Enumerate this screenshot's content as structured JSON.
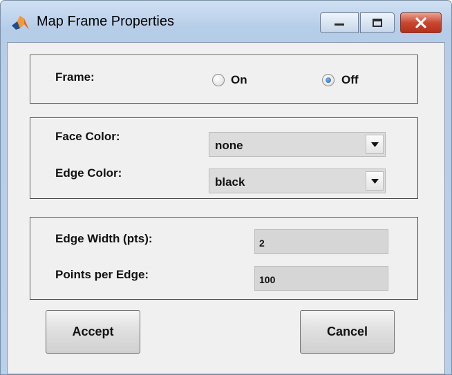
{
  "window": {
    "title": "Map Frame Properties",
    "accent": "#c9462f"
  },
  "frame_panel": {
    "label": "Frame:",
    "on_label": "On",
    "off_label": "Off",
    "selected": "Off"
  },
  "color_panel": {
    "face_label": "Face Color:",
    "face_value": "none",
    "edge_label": "Edge Color:",
    "edge_value": "black"
  },
  "edge_panel": {
    "width_label": "Edge Width (pts):",
    "width_value": "2",
    "points_label": "Points per Edge:",
    "points_value": "100"
  },
  "buttons": {
    "accept": "Accept",
    "cancel": "Cancel"
  }
}
